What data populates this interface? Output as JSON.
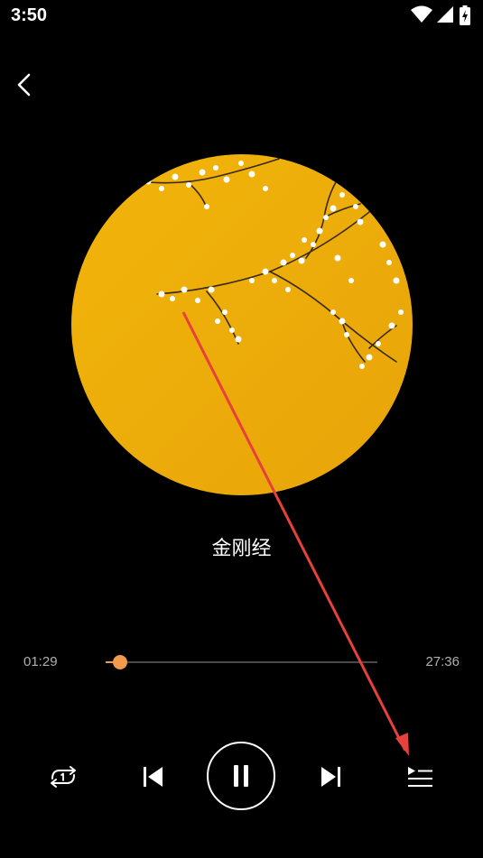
{
  "status_bar": {
    "time": "3:50",
    "icons": [
      "wifi-icon",
      "signal-icon",
      "battery-charging-icon"
    ]
  },
  "player": {
    "back_icon": "chevron-left-icon",
    "track_title": "金刚经",
    "elapsed": "01:29",
    "total": "27:36",
    "progress_fraction": 0.054,
    "accent_color": "#f39a4c",
    "cover_art": "yellow background with cherry blossom branches",
    "controls": [
      "repeat-one-icon",
      "previous-icon",
      "pause-icon",
      "next-icon",
      "playlist-icon"
    ]
  }
}
